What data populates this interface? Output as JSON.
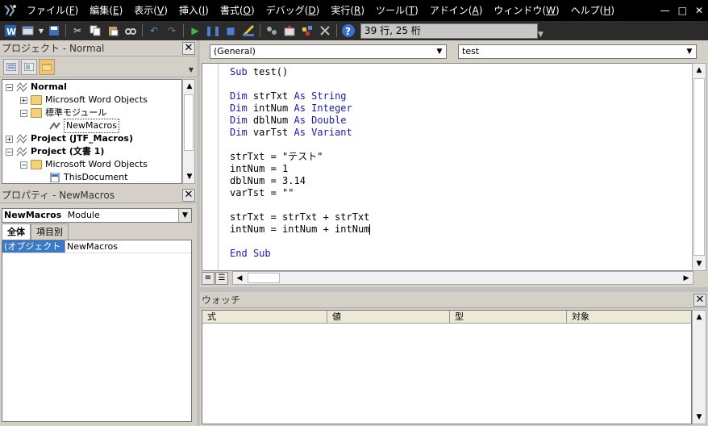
{
  "menu": {
    "items": [
      {
        "label": "ファイル",
        "key": "F"
      },
      {
        "label": "編集",
        "key": "E"
      },
      {
        "label": "表示",
        "key": "V"
      },
      {
        "label": "挿入",
        "key": "I"
      },
      {
        "label": "書式",
        "key": "O"
      },
      {
        "label": "デバッグ",
        "key": "D"
      },
      {
        "label": "実行",
        "key": "R"
      },
      {
        "label": "ツール",
        "key": "T"
      },
      {
        "label": "アドイン",
        "key": "A"
      },
      {
        "label": "ウィンドウ",
        "key": "W"
      },
      {
        "label": "ヘルプ",
        "key": "H"
      }
    ]
  },
  "toolbar": {
    "position_status": "39 行, 25 桁",
    "icons": [
      "word-icon",
      "insert-userform-icon",
      "save-icon",
      "cut-icon",
      "copy-icon",
      "paste-icon",
      "find-icon",
      "undo-icon",
      "redo-icon",
      "run-icon",
      "break-icon",
      "reset-icon",
      "design-mode-icon",
      "project-explorer-icon",
      "properties-icon",
      "object-browser-icon",
      "toolbox-icon",
      "help-icon"
    ]
  },
  "project": {
    "title": "プロジェクト - Normal",
    "tree": [
      {
        "label": "Normal",
        "bold": true
      },
      {
        "label": "Microsoft Word Objects"
      },
      {
        "label": "標準モジュール"
      },
      {
        "label": "NewMacros"
      },
      {
        "label": "Project (JTF_Macros)",
        "bold": true
      },
      {
        "label": "Project (文書 1)",
        "bold": true
      },
      {
        "label": "Microsoft Word Objects"
      },
      {
        "label": "ThisDocument"
      }
    ]
  },
  "properties": {
    "title": "プロパティ - NewMacros",
    "object_name": "NewMacros",
    "object_type": "Module",
    "tabs": [
      "全体",
      "項目別"
    ],
    "rows": [
      {
        "name": "(オブジェクト名)",
        "value": "NewMacros"
      }
    ]
  },
  "code": {
    "object_combo": "(General)",
    "proc_combo": "test",
    "lines": [
      "Sub test()",
      "",
      "Dim strTxt As String",
      "Dim intNum As Integer",
      "Dim dblNum As Double",
      "Dim varTst As Variant",
      "",
      "strTxt = \"テスト\"",
      "intNum = 1",
      "dblNum = 3.14",
      "varTst = \"\"",
      "",
      "strTxt = strTxt + strTxt",
      "intNum = intNum + intNum",
      "",
      "End Sub"
    ]
  },
  "watch": {
    "title": "ウォッチ",
    "columns": [
      "式",
      "値",
      "型",
      "対象"
    ]
  }
}
